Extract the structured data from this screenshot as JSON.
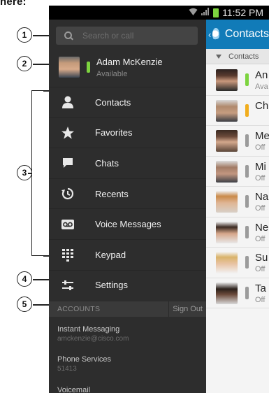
{
  "colors": {
    "available": "#7dd43f",
    "away": "#f1ad1d",
    "offline": "#9b9b9b",
    "header_blue": "#117bb8"
  },
  "callouts": [
    "1",
    "2",
    "3",
    "4",
    "5"
  ],
  "status_bar": {
    "wifi_icon": "wifi-icon",
    "signal_icon": "signal-icon",
    "battery_icon": "battery-icon",
    "time": "11:52 PM"
  },
  "drawer": {
    "search": {
      "placeholder": "Search or call",
      "icon": "search-icon"
    },
    "profile": {
      "name": "Adam McKenzie",
      "status": "Available",
      "presence": "available"
    },
    "menu": [
      {
        "label": "Contacts",
        "icon": "person-icon"
      },
      {
        "label": "Favorites",
        "icon": "star-icon"
      },
      {
        "label": "Chats",
        "icon": "chat-bubble-icon"
      },
      {
        "label": "Recents",
        "icon": "history-icon"
      },
      {
        "label": "Voice Messages",
        "icon": "voicemail-icon"
      },
      {
        "label": "Keypad",
        "icon": "keypad-icon"
      },
      {
        "label": "Settings",
        "icon": "sliders-icon"
      }
    ],
    "accounts": {
      "title": "ACCOUNTS",
      "sign_out": "Sign Out",
      "items": [
        {
          "name": "Instant Messaging",
          "detail": "amckenzie@cisco.com"
        },
        {
          "name": "Phone Services",
          "detail": "51413"
        },
        {
          "name": "Voicemail",
          "detail": ""
        }
      ]
    }
  },
  "contacts_panel": {
    "back_icon": "back-chevron-icon",
    "title": "Contacts",
    "section": "Contacts",
    "rows": [
      {
        "name": "An",
        "status": "Ava",
        "presence": "available"
      },
      {
        "name": "Ch",
        "status": "",
        "presence": "away"
      },
      {
        "name": "Me",
        "status": "Off",
        "presence": "offline"
      },
      {
        "name": "Mi",
        "status": "Off",
        "presence": "offline"
      },
      {
        "name": "Na",
        "status": "Off",
        "presence": "offline"
      },
      {
        "name": "Ne",
        "status": "Off",
        "presence": "offline"
      },
      {
        "name": "Su",
        "status": "Off",
        "presence": "offline"
      },
      {
        "name": "Ta",
        "status": "Off",
        "presence": "offline"
      }
    ]
  }
}
